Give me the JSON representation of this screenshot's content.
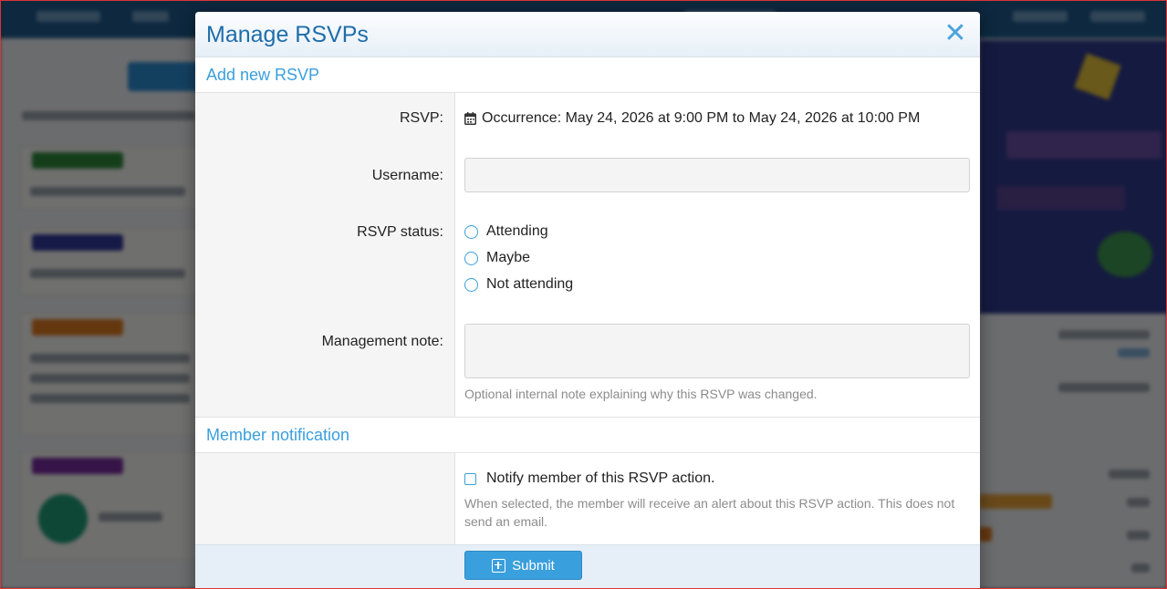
{
  "modal": {
    "title": "Manage RSVPs",
    "close_icon": "close-icon"
  },
  "add_section": {
    "heading": "Add new RSVP",
    "rsvp_label": "RSVP:",
    "calendar_icon": "calendar-icon",
    "occurrence_text": "Occurrence: May 24, 2026 at 9:00 PM to May 24, 2026 at 10:00 PM",
    "username_label": "Username:",
    "username_value": "",
    "status_label": "RSVP status:",
    "status_options": [
      "Attending",
      "Maybe",
      "Not attending"
    ],
    "note_label": "Management note:",
    "note_value": "",
    "note_hint": "Optional internal note explaining why this RSVP was changed."
  },
  "notification_section": {
    "heading": "Member notification",
    "checkbox_label": "Notify member of this RSVP action.",
    "checkbox_checked": false,
    "hint": "When selected, the member will receive an alert about this RSVP action. This does not send an email."
  },
  "footer": {
    "submit_label": "Submit",
    "submit_icon": "plus-square-icon"
  },
  "colors": {
    "accent": "#3a9fdd",
    "title": "#1e6eab",
    "footer_bg": "#e6eff7"
  }
}
